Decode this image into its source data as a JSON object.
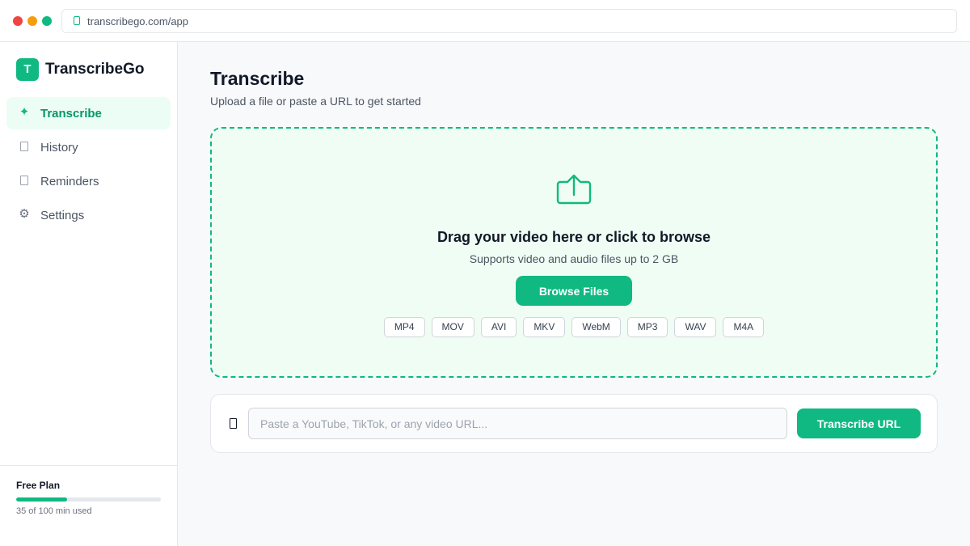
{
  "browser": {
    "url": "transcribego.com/app"
  },
  "brand": {
    "logo_letter": "T",
    "name": "TranscribeGo"
  },
  "sidebar": {
    "items": [
      {
        "label": "Transcribe",
        "icon": "sparkle-icon",
        "active": true
      },
      {
        "label": "History",
        "icon": "history-icon",
        "active": false
      },
      {
        "label": "Reminders",
        "icon": "reminders-icon",
        "active": false
      },
      {
        "label": "Settings",
        "icon": "gear-icon",
        "active": false
      }
    ],
    "plan": {
      "title": "Free Plan",
      "usage_text": "35 of 100 min used",
      "used_fraction": 0.35
    }
  },
  "main": {
    "title": "Transcribe",
    "subtitle": "Upload a file or paste a URL to get started",
    "dropzone": {
      "icon": "upload-icon",
      "title": "Drag your video here or click to browse",
      "subtitle": "Supports video and audio files up to 2 GB",
      "browse_label": "Browse Files",
      "formats": [
        "MP4",
        "MOV",
        "AVI",
        "MKV",
        "WebM",
        "MP3",
        "WAV",
        "M4A"
      ]
    },
    "url_panel": {
      "icon": "link-icon",
      "placeholder": "Paste a YouTube, TikTok, or any video URL...",
      "value": "",
      "button_label": "Transcribe URL"
    }
  },
  "colors": {
    "accent": "#10b981",
    "accent_light": "#ecfdf5",
    "dropzone_bg": "#f0fdf4"
  }
}
